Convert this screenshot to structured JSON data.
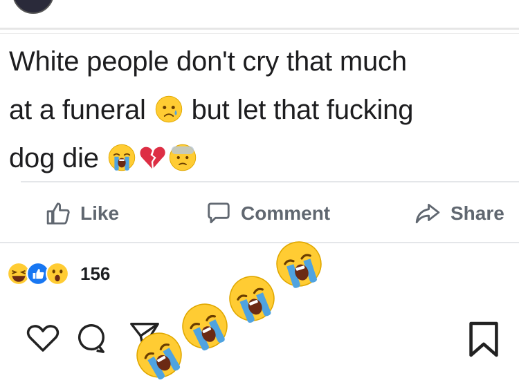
{
  "post": {
    "line1": "White people don't cry that much",
    "line2_a": "at a funeral",
    "line2_b": "but let that fucking",
    "line3": "dog die"
  },
  "actions": {
    "like_label": "Like",
    "comment_label": "Comment",
    "share_label": "Share"
  },
  "reactions": {
    "count": "156",
    "types": [
      "haha",
      "like",
      "wow"
    ]
  },
  "emojis": {
    "line2": "disappointed-relieved-emoji",
    "line3": [
      "loudly-crying-emoji",
      "broken-heart-emoji",
      "worried-emoji"
    ],
    "floating": [
      "loudly-crying-emoji",
      "loudly-crying-emoji",
      "loudly-crying-emoji",
      "loudly-crying-emoji"
    ]
  },
  "colors": {
    "action_text": "#606770",
    "like_blue": "#1877f2",
    "emoji_yellow": "#ffcc33",
    "tear_blue": "#4fa3e0",
    "heart_red": "#dd2e44"
  },
  "instagram_bar": {
    "icons": [
      "heart-icon",
      "comment-icon",
      "send-icon",
      "bookmark-icon"
    ]
  }
}
